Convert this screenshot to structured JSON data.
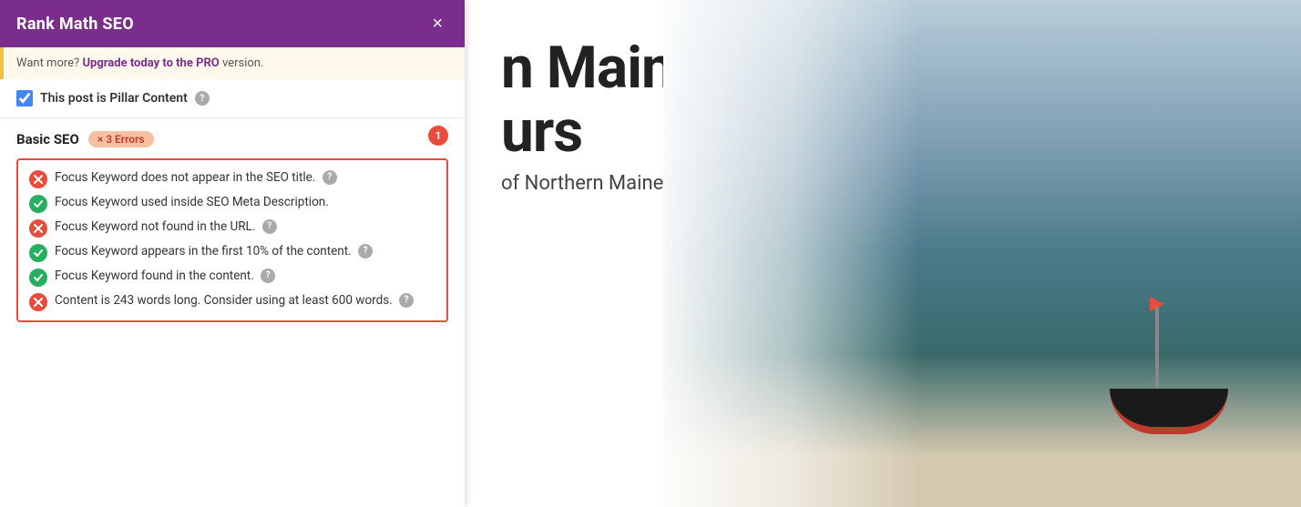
{
  "panel": {
    "title": "Rank Math SEO",
    "close_label": "×",
    "upgrade_text": "Want more?",
    "upgrade_link": "Upgrade today to the PRO",
    "upgrade_suffix": " version.",
    "pillar_label": "This post is Pillar Content",
    "pillar_checked": true
  },
  "basic_seo": {
    "title": "Basic SEO",
    "errors_badge": "× 3 Errors",
    "notification_count": "1",
    "checks": [
      {
        "type": "error",
        "text": "Focus Keyword does not appear in the SEO title.",
        "has_help": true
      },
      {
        "type": "success",
        "text": "Focus Keyword used inside SEO Meta Description.",
        "has_help": false
      },
      {
        "type": "error",
        "text": "Focus Keyword not found in the URL.",
        "has_help": true
      },
      {
        "type": "success",
        "text": "Focus Keyword appears in the first 10% of the content.",
        "has_help": true
      },
      {
        "type": "success",
        "text": "Focus Keyword found in the content.",
        "has_help": true
      },
      {
        "type": "error",
        "text": "Content is 243 words long. Consider using at least 600 words.",
        "has_help": true
      }
    ]
  },
  "content": {
    "heading_line1": "n Maine",
    "heading_line2": "urs",
    "subheading": "of Northern Maine with Seagate"
  },
  "icons": {
    "help": "?",
    "close": "×",
    "check": "✓",
    "x": "✕"
  }
}
